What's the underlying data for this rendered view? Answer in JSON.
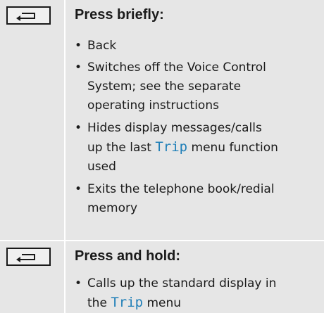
{
  "rows": [
    {
      "key_icon": "back-button-icon",
      "heading": "Press briefly:",
      "items": [
        {
          "lines": [
            "Back"
          ]
        },
        {
          "lines": [
            "Switches off the Voice Control",
            "System; see the separate",
            "operating instructions"
          ]
        },
        {
          "before": "Hides display messages/calls",
          "before2": "up the last ",
          "highlight": "Trip",
          "after": " menu function",
          "after2": "used"
        },
        {
          "lines": [
            "Exits the telephone book/redial",
            "memory"
          ]
        }
      ]
    },
    {
      "key_icon": "back-button-icon",
      "heading": "Press and hold:",
      "items": [
        {
          "before": "Calls up the standard display in",
          "before2": "the ",
          "highlight": "Trip",
          "after": " menu"
        }
      ]
    }
  ],
  "bullet_char": "•",
  "colors": {
    "background": "#e6e6e6",
    "separator": "#ffffff",
    "highlight": "#1f7fb8",
    "text": "#1a1a1a"
  }
}
